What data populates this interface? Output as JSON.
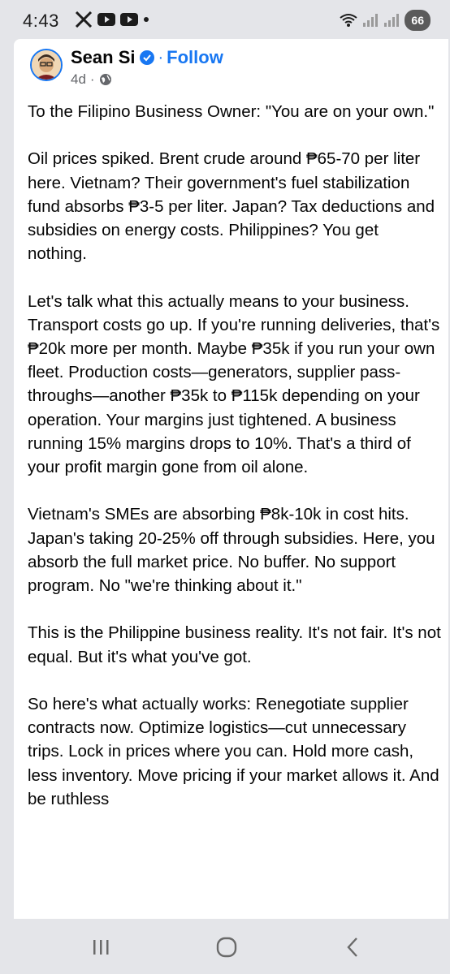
{
  "status_bar": {
    "time": "4:43",
    "battery": "66",
    "icons": [
      "x-logo-icon",
      "youtube-icon",
      "youtube-icon",
      "notification-dot-icon",
      "wifi-icon",
      "signal-icon",
      "signal-icon"
    ]
  },
  "post": {
    "author": "Sean Si",
    "follow_label": "Follow",
    "age": "4d",
    "privacy_icon": "globe-icon",
    "paragraphs": [
      "To the Filipino Business Owner: \"You are on your own.\"",
      "Oil prices spiked. Brent crude around ₱65-70 per liter here. Vietnam? Their government's fuel stabilization fund absorbs ₱3-5 per liter. Japan? Tax deductions and subsidies on energy costs. Philippines? You get nothing.",
      "Let's talk what this actually means to your business. Transport costs go up. If you're running deliveries, that's ₱20k more per month. Maybe ₱35k if you run your own fleet. Production costs—generators, supplier pass-throughs—another ₱35k to ₱115k depending on your operation. Your margins just tightened. A business running 15% margins drops to 10%. That's a third of your profit margin gone from oil alone.",
      "Vietnam's SMEs are absorbing ₱8k-10k in cost hits. Japan's taking 20-25% off through subsidies. Here, you absorb the full market price. No buffer. No support program. No \"we're thinking about it.\"",
      "This is the Philippine business reality. It's not fair. It's not equal. But it's what you've got.",
      "So here's what actually works: Renegotiate supplier contracts now. Optimize logistics—cut unnecessary trips. Lock in prices where you can. Hold more cash, less inventory. Move pricing if your market allows it. And be ruthless"
    ]
  },
  "nav_bar": {
    "buttons": [
      "recent-apps-icon",
      "home-icon",
      "back-icon"
    ]
  },
  "colors": {
    "accent": "#1877f2",
    "text": "#050505",
    "muted": "#65676b",
    "chrome": "#e4e5e9"
  }
}
